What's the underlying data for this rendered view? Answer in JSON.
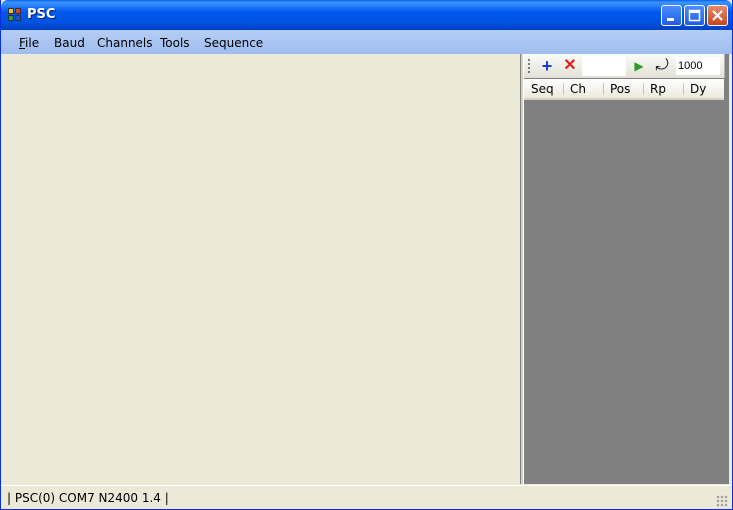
{
  "window": {
    "title": "PSC",
    "accent": "#0058EE",
    "close_color": "#C8451E"
  },
  "menu": {
    "items": [
      {
        "label": "File",
        "mnemonic": "F",
        "rest": "ile"
      },
      {
        "label": "Baud"
      },
      {
        "label": "Channels"
      },
      {
        "label": "Tools"
      },
      {
        "label": "Sequence"
      }
    ]
  },
  "toolbar": {
    "add_icon": "+",
    "delete_icon": "✕",
    "play_icon": "▶",
    "loop_icon": "⤾",
    "delay_value": "1000"
  },
  "sequence_list": {
    "columns": [
      "Seq",
      "Ch",
      "Pos",
      "Rp",
      "Dy"
    ]
  },
  "status": {
    "text": "| PSC(0) COM7 N2400 1.4 |"
  }
}
